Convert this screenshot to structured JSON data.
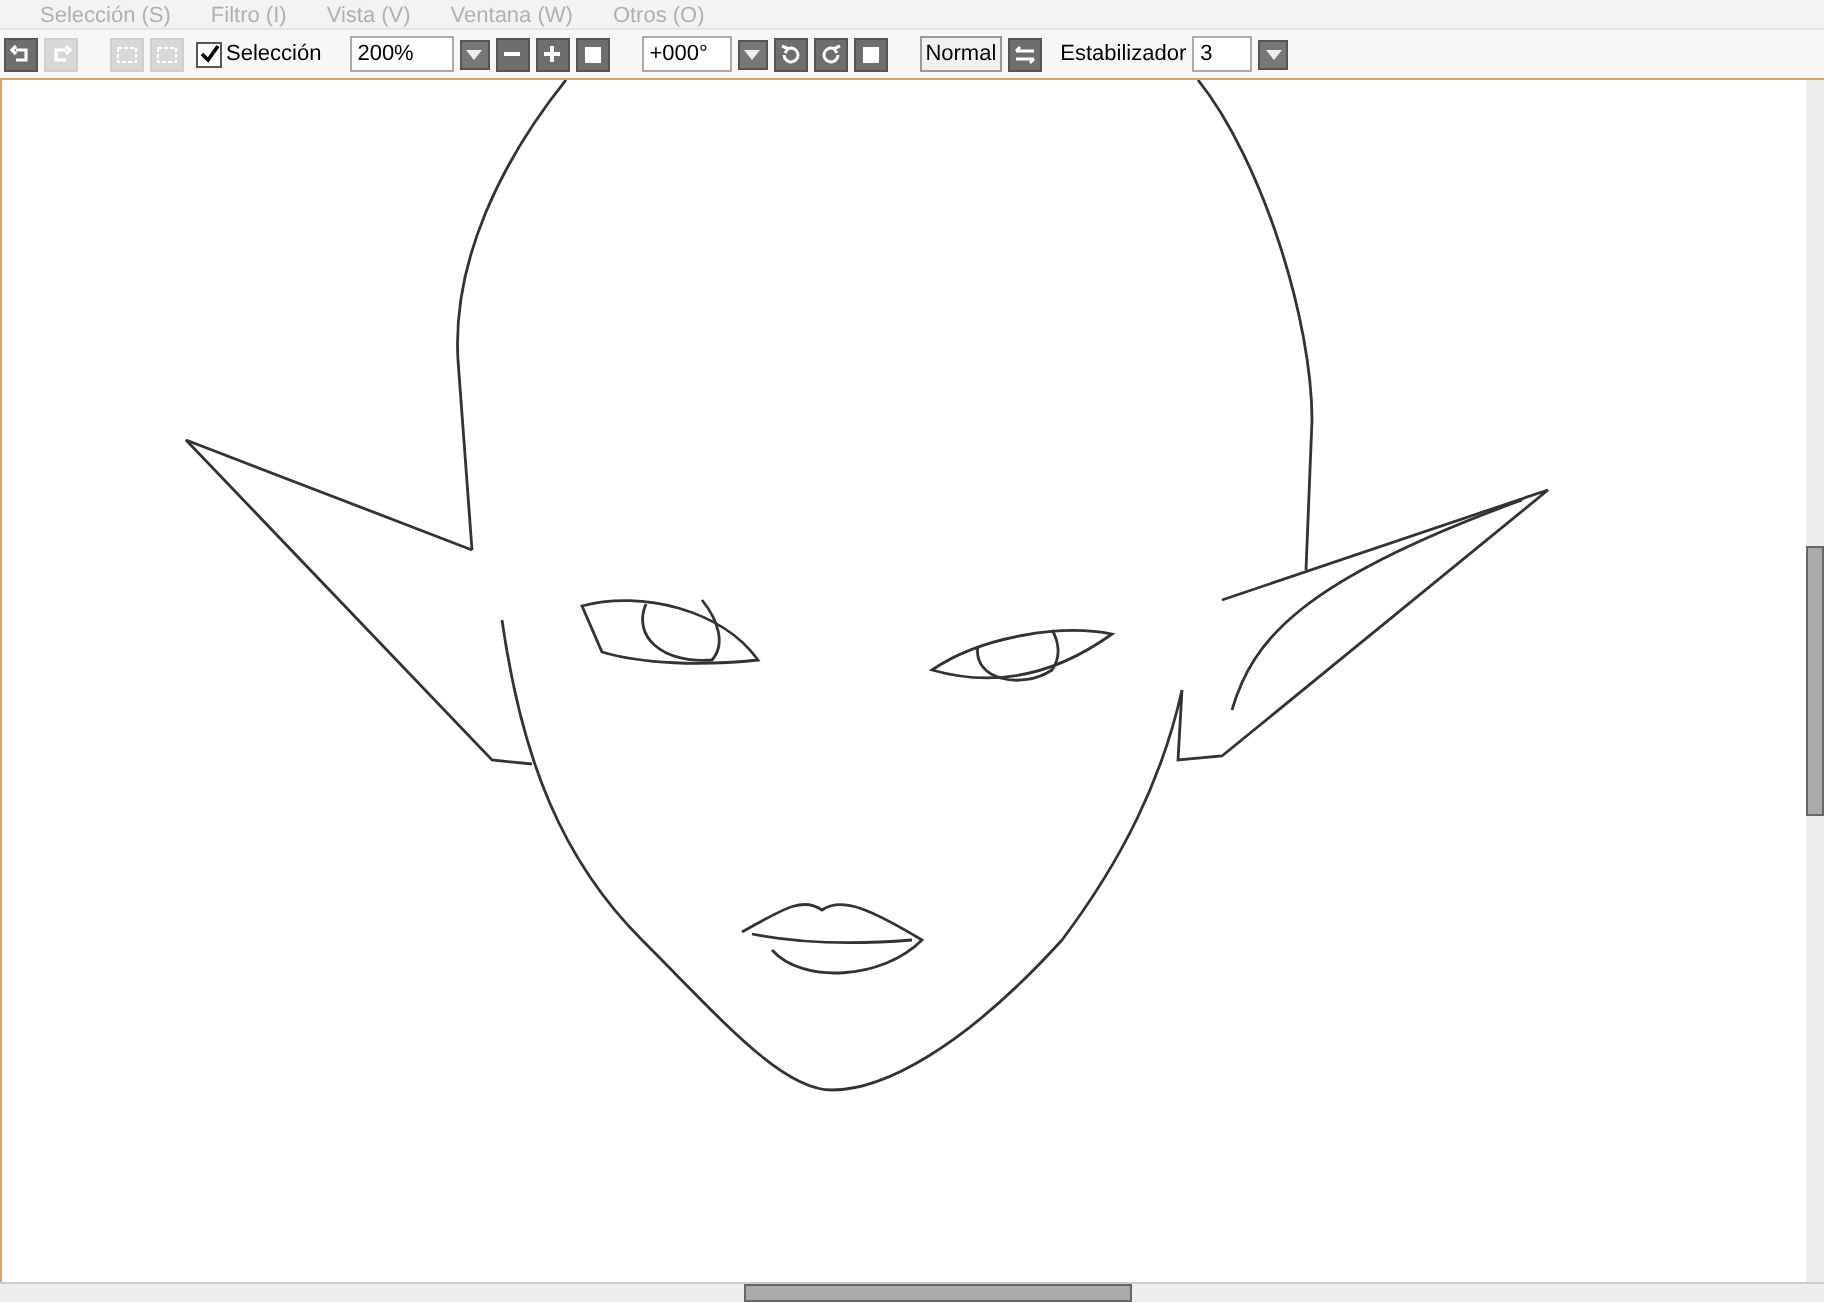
{
  "menu_bar": {
    "items": [
      "Selección (S)",
      "Filtro (I)",
      "Vista (V)",
      "Ventana (W)",
      "Otros (O)"
    ]
  },
  "toolbar": {
    "undo": {
      "disabled": false
    },
    "redo": {
      "disabled": true
    },
    "selection_tools": [
      {
        "disabled": true
      },
      {
        "disabled": true
      }
    ],
    "selection_checkbox": {
      "label": "Selección",
      "checked": true
    },
    "zoom": {
      "value": "200%"
    },
    "rotation": {
      "value": "+000°"
    },
    "blend_button": "Normal",
    "stabilizer": {
      "label": "Estabilizador",
      "value": "3"
    }
  }
}
